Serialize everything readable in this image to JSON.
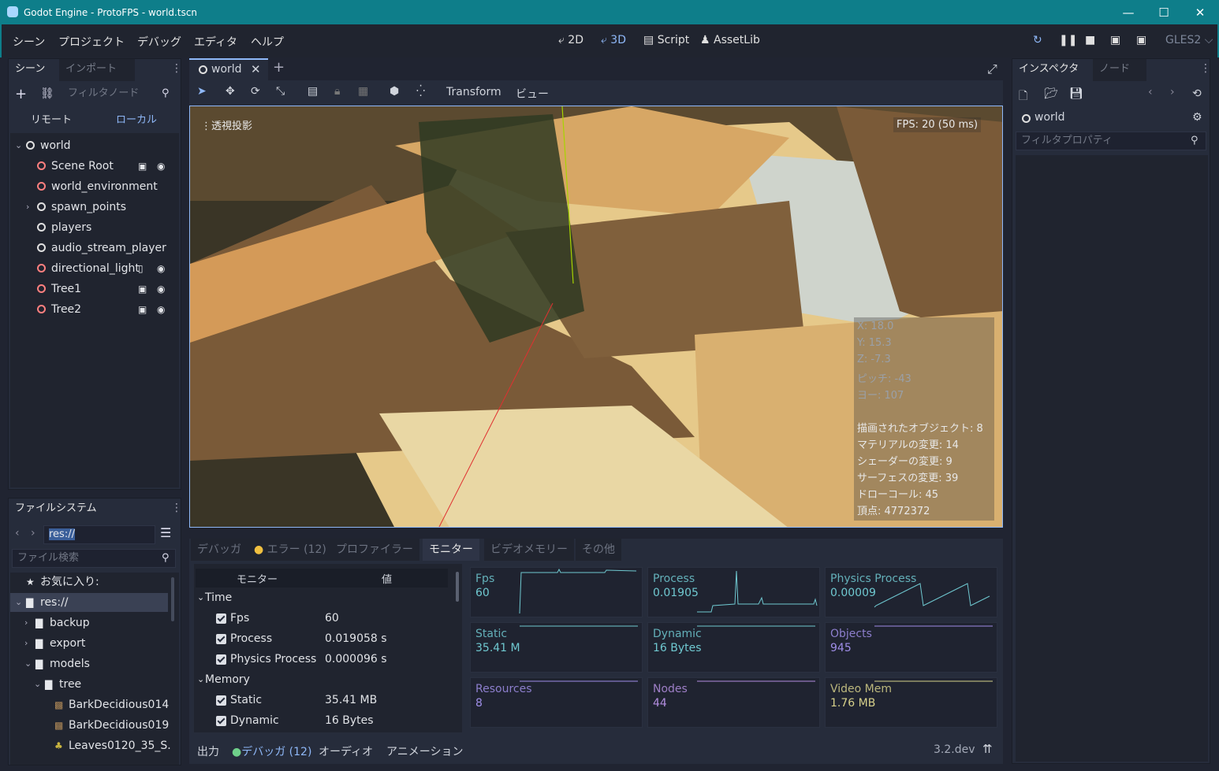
{
  "window": {
    "title": "Godot Engine - ProtoFPS - world.tscn",
    "minimize": "—",
    "maximize": "☐",
    "close": "✕"
  },
  "menu": [
    "シーン",
    "プロジェクト",
    "デバッグ",
    "エディタ",
    "ヘルプ"
  ],
  "workspaces": {
    "w2d": "2D",
    "w3d": "3D",
    "script": "Script",
    "assetlib": "AssetLib"
  },
  "renderer": "GLES2",
  "scene_dock": {
    "tab_scene": "シーン",
    "tab_import": "インポート",
    "filter_placeholder": "フィルタノード",
    "remote": "リモート",
    "local": "ローカル",
    "nodes": [
      {
        "name": "world",
        "depth": 0,
        "icon": "node3d-icon",
        "color": "#e0e0e0",
        "expand": "v"
      },
      {
        "name": "Scene Root",
        "depth": 1,
        "icon": "spatial-icon",
        "color": "#fc7f7f",
        "badges": [
          "scene",
          "eye"
        ]
      },
      {
        "name": "world_environment",
        "depth": 1,
        "icon": "globe-icon",
        "color": "#fc7f7f"
      },
      {
        "name": "spawn_points",
        "depth": 1,
        "icon": "node3d-icon",
        "color": "#e0e0e0",
        "expand": ">"
      },
      {
        "name": "players",
        "depth": 1,
        "icon": "node3d-icon",
        "color": "#e0e0e0"
      },
      {
        "name": "audio_stream_player",
        "depth": 1,
        "icon": "audio-icon",
        "color": "#e0e0e0"
      },
      {
        "name": "directional_light",
        "depth": 1,
        "icon": "light-icon",
        "color": "#fc7f7f",
        "badges": [
          "script",
          "eye"
        ]
      },
      {
        "name": "Tree1",
        "depth": 1,
        "icon": "spatial-icon",
        "color": "#fc7f7f",
        "badges": [
          "scene",
          "eye"
        ]
      },
      {
        "name": "Tree2",
        "depth": 1,
        "icon": "spatial-icon",
        "color": "#fc7f7f",
        "badges": [
          "scene",
          "eye"
        ]
      }
    ]
  },
  "fs_dock": {
    "title": "ファイルシステム",
    "path": "res://",
    "search_placeholder": "ファイル検索",
    "items": [
      {
        "name": "お気に入り:",
        "depth": 0,
        "icon": "star-icon"
      },
      {
        "name": "res://",
        "depth": 0,
        "icon": "folder-icon",
        "expand": "v",
        "selected": true
      },
      {
        "name": "backup",
        "depth": 1,
        "icon": "folder-icon",
        "expand": ">"
      },
      {
        "name": "export",
        "depth": 1,
        "icon": "folder-icon",
        "expand": ">"
      },
      {
        "name": "models",
        "depth": 1,
        "icon": "folder-icon",
        "expand": "v"
      },
      {
        "name": "tree",
        "depth": 2,
        "icon": "folder-icon",
        "expand": "v"
      },
      {
        "name": "BarkDecidious014",
        "depth": 3,
        "icon": "texture-icon"
      },
      {
        "name": "BarkDecidious019",
        "depth": 3,
        "icon": "texture-icon"
      },
      {
        "name": "Leaves0120_35_S.",
        "depth": 3,
        "icon": "leaf-icon"
      }
    ]
  },
  "editor": {
    "scene_tab": "world",
    "close": "✕",
    "add": "+",
    "transform": "Transform",
    "view": "ビュー"
  },
  "viewport": {
    "perspective": "透視投影",
    "fps": "FPS: 20 (50 ms)",
    "stats": [
      "X: 18.0",
      "Y: 15.3",
      "Z: -7.3",
      "ピッチ: -43",
      "ヨー: 107",
      "",
      "描画されたオブジェクト: 8",
      "マテリアルの変更: 14",
      "シェーダーの変更: 9",
      "サーフェスの変更: 39",
      "ドローコール: 45",
      "頂点: 4772372"
    ]
  },
  "debugger": {
    "tabs": [
      "デバッガ",
      "エラー (12)",
      "プロファイラー",
      "モニター",
      "ビデオメモリー",
      "その他"
    ],
    "active": 3,
    "col_monitor": "モニター",
    "col_value": "値",
    "rows": [
      {
        "type": "group",
        "label": "Time"
      },
      {
        "type": "item",
        "label": "Fps",
        "value": "60"
      },
      {
        "type": "item",
        "label": "Process",
        "value": "0.019058 s"
      },
      {
        "type": "item",
        "label": "Physics Process",
        "value": "0.000096 s"
      },
      {
        "type": "group",
        "label": "Memory"
      },
      {
        "type": "item",
        "label": "Static",
        "value": "35.41 MB"
      },
      {
        "type": "item",
        "label": "Dynamic",
        "value": "16 Bytes"
      }
    ],
    "graphs": [
      {
        "label": "Fps",
        "value": "60",
        "color": "#6fc8d0"
      },
      {
        "label": "Process",
        "value": "0.01905",
        "color": "#6fc8d0"
      },
      {
        "label": "Physics Process",
        "value": "0.00009",
        "color": "#6fc8d0"
      },
      {
        "label": "Static",
        "value": "35.41 M",
        "color": "#6fc8d0"
      },
      {
        "label": "Dynamic",
        "value": "16 Bytes",
        "color": "#6fc8d0"
      },
      {
        "label": "Objects",
        "value": "945",
        "color": "#9f8ee8"
      },
      {
        "label": "Resources",
        "value": "8",
        "color": "#9f8ee8"
      },
      {
        "label": "Nodes",
        "value": "44",
        "color": "#b38ee0"
      },
      {
        "label": "Video Mem",
        "value": "1.76 MB",
        "color": "#d6d08a"
      }
    ]
  },
  "bottom_bar": {
    "output": "出力",
    "debugger": "デバッガ (12)",
    "audio": "オーディオ",
    "animation": "アニメーション",
    "version": "3.2.dev"
  },
  "inspector": {
    "tab_inspector": "インスペクタ",
    "tab_node": "ノード",
    "object": "world",
    "filter_placeholder": "フィルタプロパティ"
  }
}
